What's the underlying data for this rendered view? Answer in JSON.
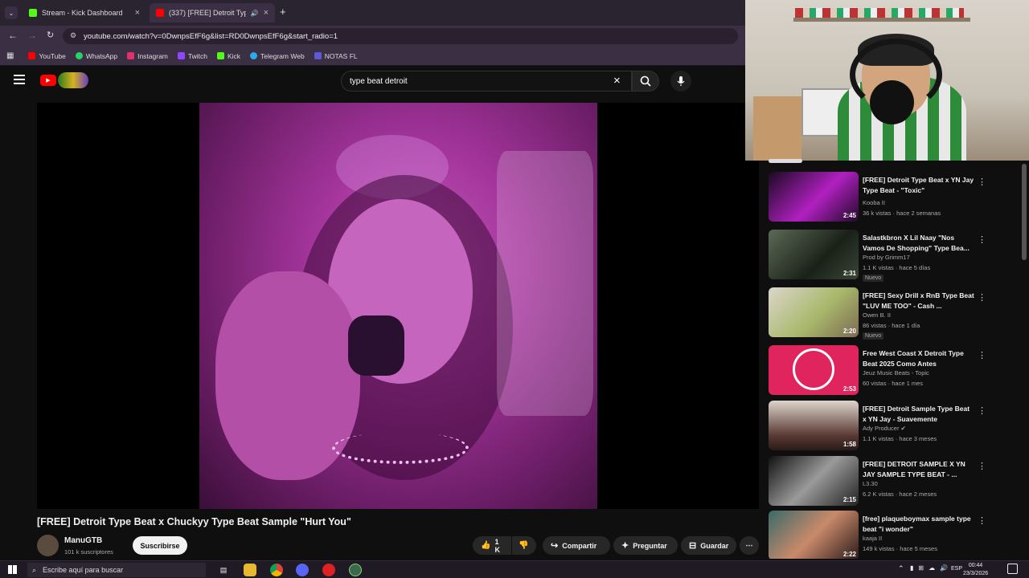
{
  "browser": {
    "tabs": [
      {
        "label": "Stream - Kick Dashboard",
        "favicon_color": "#53fc18"
      },
      {
        "label": "(337) [FREE] Detroit Type Be...",
        "favicon_color": "#ff0000"
      }
    ],
    "url": "youtube.com/watch?v=0DwnpsEfF6g&list=RD0DwnpsEfF6g&start_radio=1",
    "bookmarks": [
      {
        "label": "YouTube",
        "icon": "youtube-icon",
        "color": "#ff0000"
      },
      {
        "label": "WhatsApp",
        "icon": "whatsapp-icon",
        "color": "#25d366"
      },
      {
        "label": "Instagram",
        "icon": "instagram-icon",
        "color": "#e1306c"
      },
      {
        "label": "Twitch",
        "icon": "twitch-icon",
        "color": "#9146ff"
      },
      {
        "label": "Kick",
        "icon": "kick-icon",
        "color": "#53fc18"
      },
      {
        "label": "Telegram Web",
        "icon": "telegram-icon",
        "color": "#2aabee"
      },
      {
        "label": "NOTAS FL",
        "icon": "notas-icon",
        "color": "#5b5bd6"
      }
    ]
  },
  "youtube": {
    "search_query": "type beat detroit",
    "video": {
      "title": "[FREE] Detroit Type Beat x Chuckyy Type Beat Sample \"Hurt You\"",
      "channel": "ManuGTB",
      "subscribers": "101 k suscriptores",
      "subscribe_label": "Suscribirse",
      "likes": "1 K",
      "share_label": "Compartir",
      "ask_label": "Preguntar",
      "save_label": "Guardar"
    },
    "recommendations": [
      {
        "title": "[FREE] Detroit Type Beat x YN Jay Type Beat - \"Toxic\"",
        "channel": "Kooba II",
        "meta": "36 k vistas · hace 2 semanas",
        "duration": "2:45",
        "badge": "",
        "thumb_color": "#3a1850"
      },
      {
        "title": "Salastkbron X Lil Naay \"Nos Vamos De Shopping\" Type Bea...",
        "channel": "Prod by Grimm17",
        "meta": "1.1 K vistas · hace 5 días",
        "duration": "2:31",
        "badge": "Nuevo",
        "thumb_color": "#2a3a2a"
      },
      {
        "title": "[FREE] Sexy Drill x RnB Type Beat \"LUV ME TOO\" - Cash ...",
        "channel": "Owen B. II",
        "meta": "86 vistas · hace 1 día",
        "duration": "2:20",
        "badge": "Nuevo",
        "thumb_color": "#5a6a4a"
      },
      {
        "title": "Free West Coast X Detroit Type Beat 2025 Como Antes",
        "channel": "Jeuz Music Beats - Topic",
        "meta": "60 vistas · hace 1 mes",
        "duration": "2:53",
        "badge": "",
        "thumb_color": "#e0245e"
      },
      {
        "title": "[FREE] Detroit Sample Type Beat x YN Jay - Suavemente",
        "channel": "Ady Producer",
        "meta": "1.1 K vistas · hace 3 meses",
        "duration": "1:58",
        "badge": "",
        "thumb_color": "#b9a89a"
      },
      {
        "title": "[FREE] DETROIT SAMPLE X YN JAY SAMPLE TYPE BEAT - ...",
        "channel": "L3.30",
        "meta": "6.2 K vistas · hace 2 meses",
        "duration": "2:15",
        "badge": "",
        "thumb_color": "#777777"
      },
      {
        "title": "[free] plaqueboymax sample type beat \"i wonder\"",
        "channel": "kaaja II",
        "meta": "149 k vistas · hace 5 meses",
        "duration": "2:22",
        "badge": "",
        "thumb_color": "#6a4a3a"
      }
    ]
  },
  "taskbar": {
    "search_placeholder": "Escribe aquí para buscar",
    "language": "ESP",
    "time": "00:44",
    "date": "23/3/2026"
  }
}
